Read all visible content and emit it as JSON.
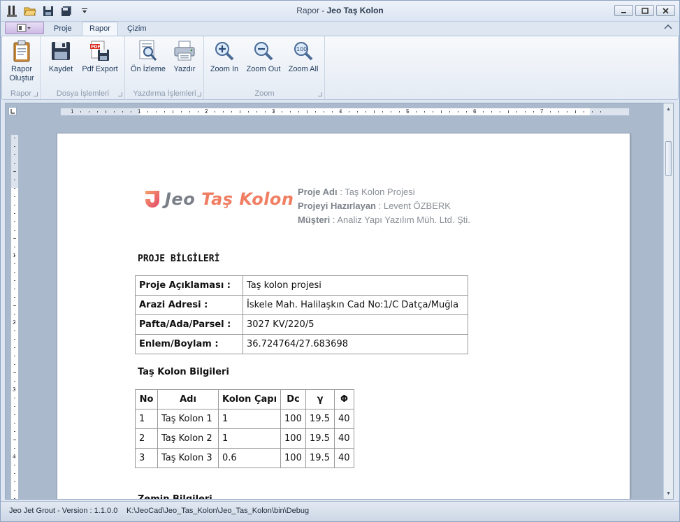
{
  "window": {
    "title_prefix": "Rapor - ",
    "title_app": "Jeo Taş Kolon"
  },
  "tabs": [
    {
      "label": "Proje"
    },
    {
      "label": "Rapor"
    },
    {
      "label": "Çizim"
    }
  ],
  "ribbon": {
    "groups": [
      {
        "label": "Rapor",
        "buttons": [
          {
            "label": "Rapor\nOluştur",
            "icon": "clipboard-icon"
          }
        ]
      },
      {
        "label": "Dosya İşlemleri",
        "buttons": [
          {
            "label": "Kaydet",
            "icon": "save-icon"
          },
          {
            "label": "Pdf Export",
            "icon": "pdf-icon"
          }
        ]
      },
      {
        "label": "Yazdırma İşlemleri",
        "buttons": [
          {
            "label": "Ön İzleme",
            "icon": "preview-icon"
          },
          {
            "label": "Yazdır",
            "icon": "printer-icon"
          }
        ]
      },
      {
        "label": "Zoom",
        "buttons": [
          {
            "label": "Zoom In",
            "icon": "zoom-in-icon"
          },
          {
            "label": "Zoom Out",
            "icon": "zoom-out-icon"
          },
          {
            "label": "Zoom All",
            "icon": "zoom-all-icon"
          }
        ]
      }
    ]
  },
  "ruler": {
    "h_numbers": [
      "1",
      "1",
      "2",
      "3",
      "4",
      "5",
      "6",
      "7"
    ],
    "v_numbers": [
      "1",
      "2",
      "3",
      "4"
    ]
  },
  "document": {
    "logo": {
      "jeo": "Jeo",
      "tas": "Taş Kolon"
    },
    "meta": [
      {
        "key": "Proje Adı",
        "value": "Taş Kolon Projesi"
      },
      {
        "key": "Projeyi Hazırlayan",
        "value": "Levent ÖZBERK"
      },
      {
        "key": "Müşteri",
        "value": "Analiz Yapı Yazılım Müh. Ltd. Şti."
      }
    ],
    "section1_title": "PROJE BİLGİLERİ",
    "project_info": [
      {
        "key": "Proje Açıklaması :",
        "value": "Taş kolon projesi"
      },
      {
        "key": "Arazi Adresi :",
        "value": "İskele Mah. Halilaşkın Cad No:1/C Datça/Muğla"
      },
      {
        "key": "Pafta/Ada/Parsel :",
        "value": "3027 KV/220/5"
      },
      {
        "key": "Enlem/Boylam :",
        "value": "36.724764/27.683698"
      }
    ],
    "section2_title": "Taş Kolon Bilgileri",
    "columns_table": {
      "headers": [
        "No",
        "Adı",
        "Kolon Çapı",
        "Dc",
        "γ",
        "Φ"
      ],
      "rows": [
        [
          "1",
          "Taş Kolon 1",
          "1",
          "100",
          "19.5",
          "40"
        ],
        [
          "2",
          "Taş Kolon 2",
          "1",
          "100",
          "19.5",
          "40"
        ],
        [
          "3",
          "Taş Kolon 3",
          "0.6",
          "100",
          "19.5",
          "40"
        ]
      ]
    },
    "section3_title": "Zemin Bilgileri"
  },
  "statusbar": {
    "version": "Jeo Jet Grout - Version : 1.1.0.0",
    "path": "K:\\JeoCad\\Jeo_Tas_Kolon\\Jeo_Tas_Kolon\\bin\\Debug"
  }
}
